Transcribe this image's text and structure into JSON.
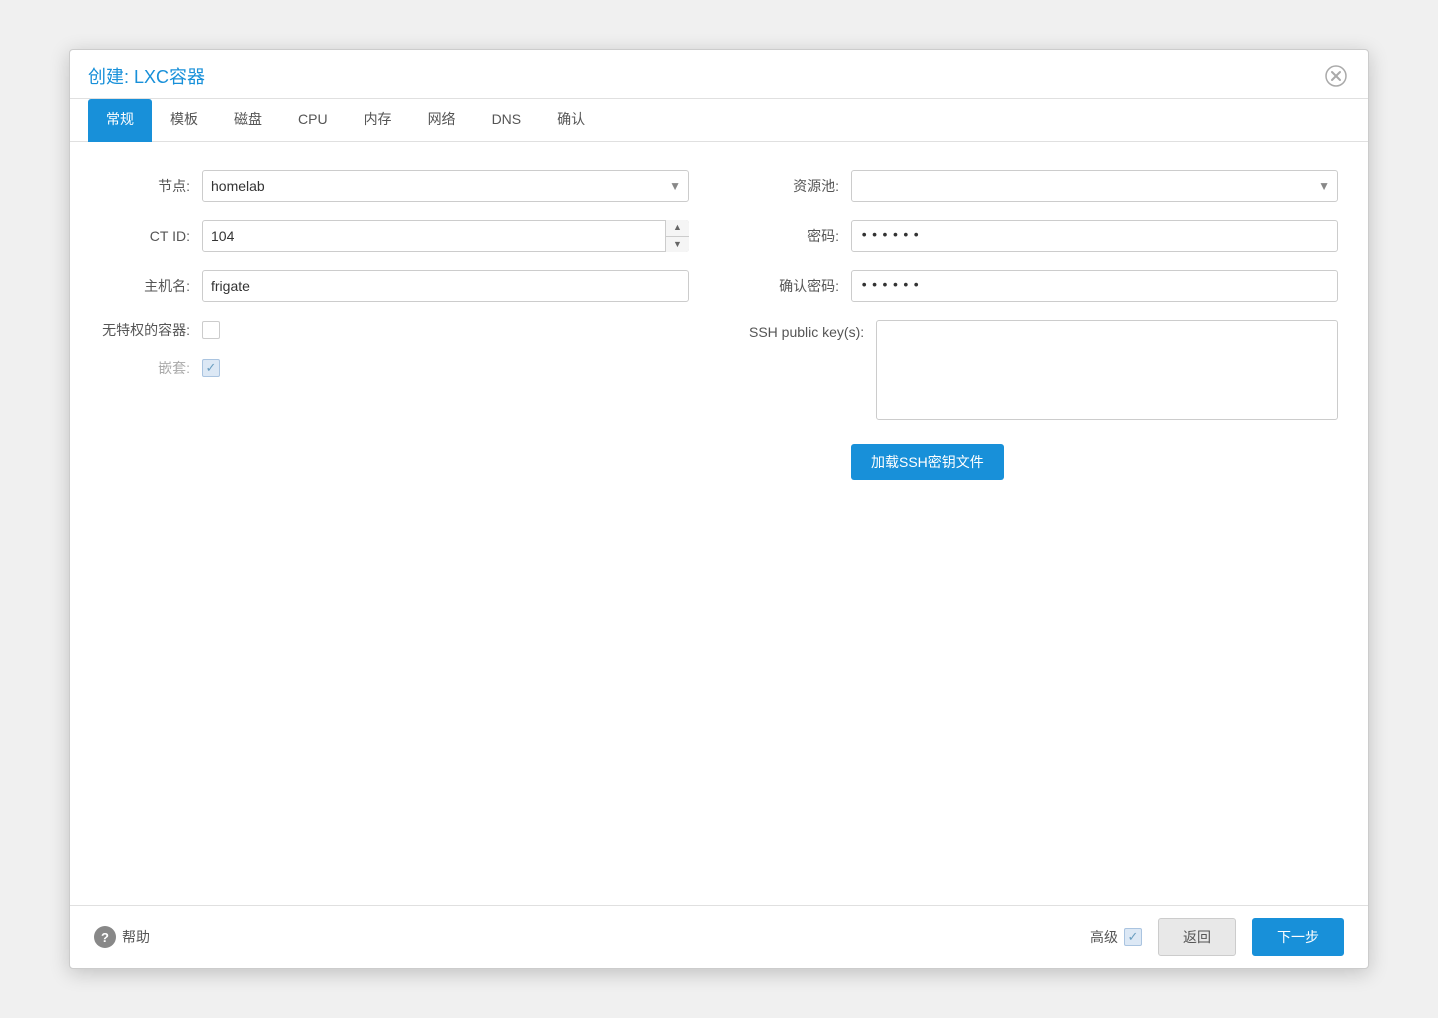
{
  "dialog": {
    "title_prefix": "创建: ",
    "title_main": "LXC容器"
  },
  "tabs": [
    {
      "label": "常规",
      "active": true
    },
    {
      "label": "模板",
      "active": false
    },
    {
      "label": "磁盘",
      "active": false
    },
    {
      "label": "CPU",
      "active": false
    },
    {
      "label": "内存",
      "active": false
    },
    {
      "label": "网络",
      "active": false
    },
    {
      "label": "DNS",
      "active": false
    },
    {
      "label": "确认",
      "active": false
    }
  ],
  "form": {
    "left": {
      "node_label": "节点:",
      "node_value": "homelab",
      "ctid_label": "CT ID:",
      "ctid_value": "104",
      "hostname_label": "主机名:",
      "hostname_value": "frigate",
      "unprivileged_label": "无特权的容器:",
      "unprivileged_checked": false,
      "nesting_label": "嵌套:",
      "nesting_checked": true
    },
    "right": {
      "pool_label": "资源池:",
      "pool_value": "",
      "password_label": "密码:",
      "password_value": "••••••",
      "confirm_password_label": "确认密码:",
      "confirm_password_value": "••••••",
      "ssh_label": "SSH public key(s):",
      "ssh_value": "",
      "load_ssh_btn": "加载SSH密钥文件"
    }
  },
  "footer": {
    "help_label": "帮助",
    "advanced_label": "高级",
    "back_btn": "返回",
    "next_btn": "下一步"
  }
}
